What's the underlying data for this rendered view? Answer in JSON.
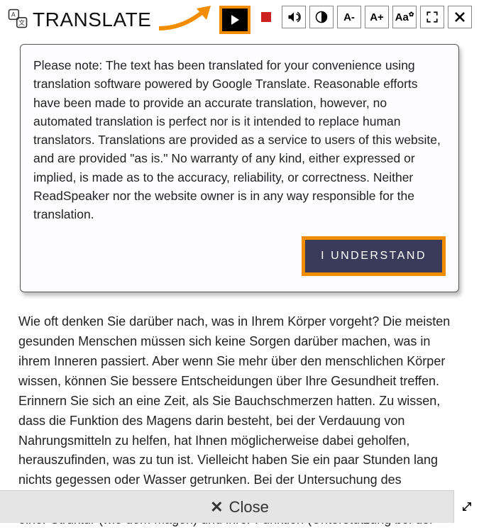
{
  "header": {
    "title": "TRANSLATE"
  },
  "toolbar": {
    "icons": {
      "translate": "translate-icon",
      "play": "play-icon",
      "stop": "stop-icon",
      "volume": "volume-icon",
      "contrast": "contrast-icon",
      "font_decrease": "A-",
      "font_increase": "A+",
      "font_settings": "Aa",
      "fullscreen": "fullscreen-icon",
      "close": "close-icon"
    }
  },
  "disclaimer": {
    "text": "Please note: The text has been translated for your convenience using translation software powered by Google Translate. Reasonable efforts have been made to provide an accurate translation, however, no automated translation is perfect nor is it intended to replace human translators. Translations are provided as a service to users of this website, and are provided \"as is.\" No warranty of any kind, either expressed or implied, is made as to the accuracy, reliability, or correctness. Neither ReadSpeaker nor the website owner is in any way responsible for the translation.",
    "button_label": "I UNDERSTAND"
  },
  "body": {
    "text": "Wie oft denken Sie darüber nach, was in Ihrem Körper vorgeht? Die meisten gesunden Menschen müssen sich keine Sorgen darüber machen, was in ihrem Inneren passiert. Aber wenn Sie mehr über den menschlichen Körper wissen, können Sie bessere Entscheidungen über Ihre Gesundheit treffen. Erinnern Sie sich an eine Zeit, als Sie Bauchschmerzen hatten. Zu wissen, dass die Funktion des Magens darin besteht, bei der Verdauung von Nahrungsmitteln zu helfen, hat Ihnen möglicherweise dabei geholfen, herauszufinden, was zu tun ist. Vielleicht haben Sie ein paar Stunden lang nichts gegessen oder Wasser getrunken. Bei der Untersuchung des menschlichen Körpers untersuchen Wissenschaftler die Beziehung zwischen einer Struktur (wie dem Magen) und ihrer Funktion (Unterstützung bei der"
  },
  "footer": {
    "close_label": "Close"
  },
  "colors": {
    "highlight": "#f28c00",
    "button_bg": "#3a3a5a"
  }
}
